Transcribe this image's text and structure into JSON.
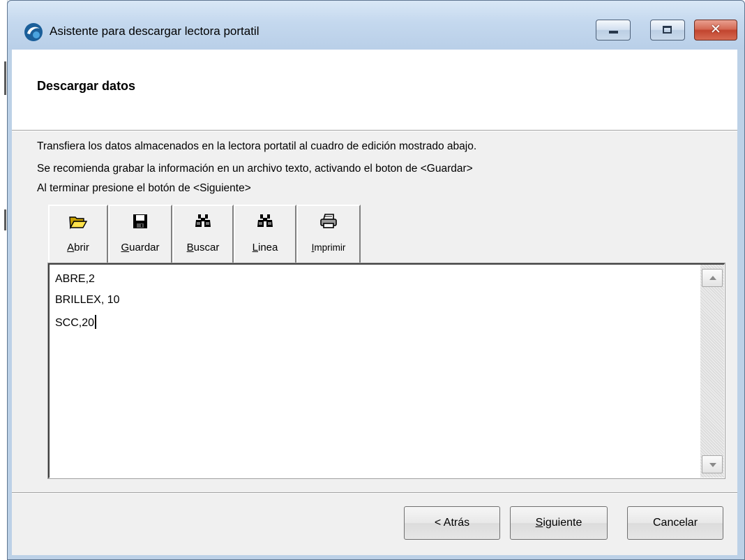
{
  "window": {
    "title": "Asistente para descargar lectora portatil",
    "accent_color": "#bcd1e7",
    "close_color": "#c2452f"
  },
  "header": {
    "title": "Descargar datos"
  },
  "instructions": [
    "Transfiera los datos almacenados en la lectora portatil al cuadro de edición mostrado abajo.",
    "Se recomienda grabar la información en un archivo texto, activando el boton de <Guardar>",
    "Al terminar presione el botón de <Siguiente>"
  ],
  "toolbar": {
    "buttons": [
      {
        "icon": "open-folder-icon",
        "mnemonic": "A",
        "rest": "brir"
      },
      {
        "icon": "floppy-disk-icon",
        "mnemonic": "G",
        "rest": "uardar"
      },
      {
        "icon": "binoculars-icon",
        "mnemonic": "B",
        "rest": "uscar"
      },
      {
        "icon": "binoculars-icon",
        "mnemonic": "L",
        "rest": "inea"
      },
      {
        "icon": "printer-icon",
        "mnemonic": "I",
        "rest": "mprimir"
      }
    ]
  },
  "editor": {
    "lines": [
      "ABRE,2",
      "BRILLEX, 10",
      "SCC,20"
    ]
  },
  "footer": {
    "back_label": "< Atrás",
    "next_mnemonic": "S",
    "next_rest": "iguiente",
    "cancel_label": "Cancelar"
  }
}
